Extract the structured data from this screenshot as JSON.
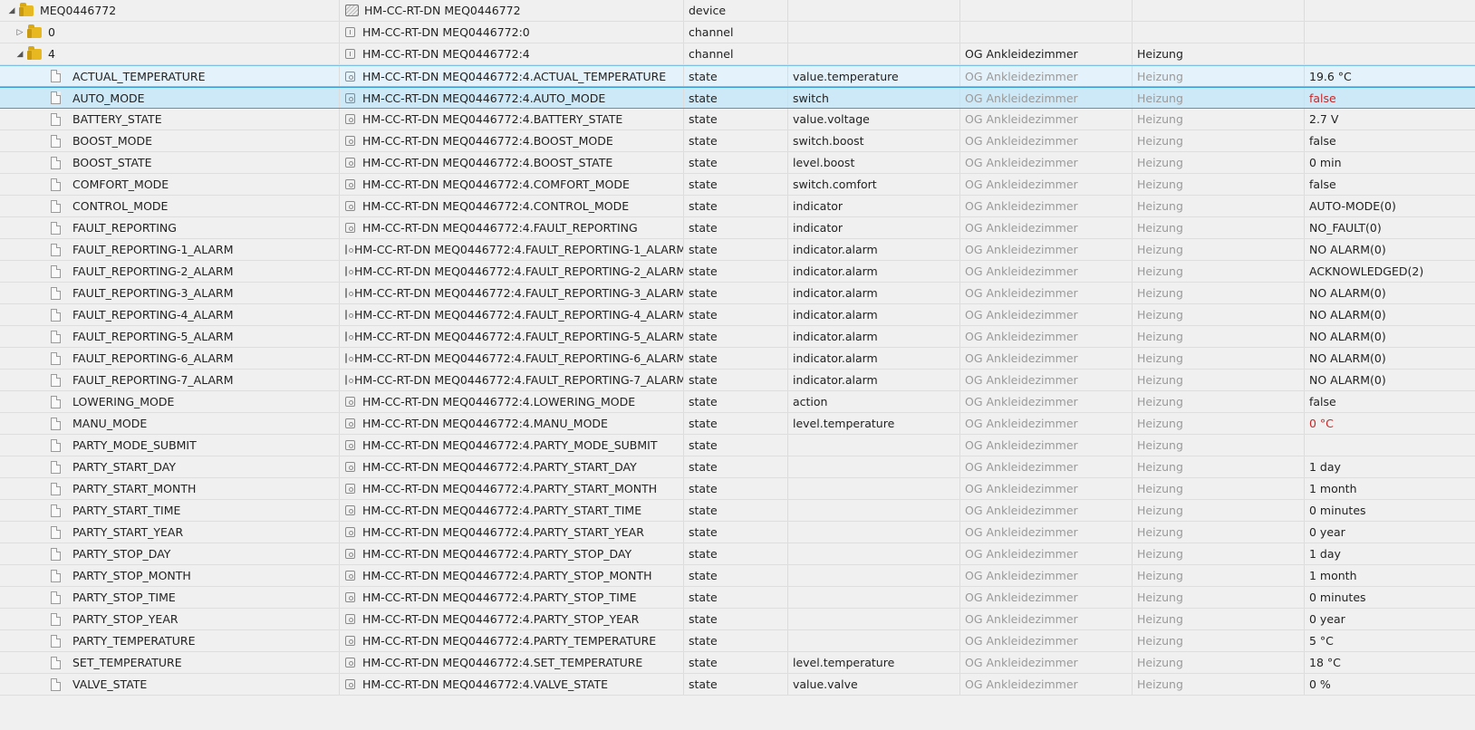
{
  "rows": [
    {
      "level": 0,
      "kind": "device",
      "toggle": "◢",
      "name": "MEQ0446772",
      "label": "HM-CC-RT-DN MEQ0446772",
      "type": "device",
      "role": "",
      "room": "",
      "function": "",
      "value": "",
      "icon": "folder-icon",
      "label_icon": "device-icon"
    },
    {
      "level": 1,
      "kind": "channel",
      "toggle": "▷",
      "name": "0",
      "label": "HM-CC-RT-DN MEQ0446772:0",
      "type": "channel",
      "role": "",
      "room": "",
      "function": "",
      "value": "",
      "icon": "folder-icon",
      "label_icon": "channel-icon"
    },
    {
      "level": 1,
      "kind": "channel",
      "toggle": "◢",
      "name": "4",
      "label": "HM-CC-RT-DN MEQ0446772:4",
      "type": "channel",
      "role": "",
      "room": "OG Ankleidezimmer",
      "function": "Heizung",
      "value": "",
      "icon": "folder-icon",
      "label_icon": "channel-icon"
    },
    {
      "level": 2,
      "kind": "state",
      "state": "hover",
      "name": "ACTUAL_TEMPERATURE",
      "label": "HM-CC-RT-DN MEQ0446772:4.ACTUAL_TEMPERATURE",
      "type": "state",
      "role": "value.temperature",
      "room": "OG Ankleidezimmer",
      "function": "Heizung",
      "value": "19.6 °C",
      "icon": "file-icon",
      "label_icon": "state-icon"
    },
    {
      "level": 2,
      "kind": "state",
      "state": "selected",
      "name": "AUTO_MODE",
      "label": "HM-CC-RT-DN MEQ0446772:4.AUTO_MODE",
      "type": "state",
      "role": "switch",
      "room": "OG Ankleidezimmer",
      "function": "Heizung",
      "value": "false",
      "value_color": "red",
      "icon": "file-icon",
      "label_icon": "state-icon"
    },
    {
      "level": 2,
      "kind": "state",
      "name": "BATTERY_STATE",
      "label": "HM-CC-RT-DN MEQ0446772:4.BATTERY_STATE",
      "type": "state",
      "role": "value.voltage",
      "room": "OG Ankleidezimmer",
      "function": "Heizung",
      "value": "2.7 V",
      "icon": "file-icon",
      "label_icon": "state-icon"
    },
    {
      "level": 2,
      "kind": "state",
      "name": "BOOST_MODE",
      "label": "HM-CC-RT-DN MEQ0446772:4.BOOST_MODE",
      "type": "state",
      "role": "switch.boost",
      "room": "OG Ankleidezimmer",
      "function": "Heizung",
      "value": "false",
      "icon": "file-icon",
      "label_icon": "state-icon"
    },
    {
      "level": 2,
      "kind": "state",
      "name": "BOOST_STATE",
      "label": "HM-CC-RT-DN MEQ0446772:4.BOOST_STATE",
      "type": "state",
      "role": "level.boost",
      "room": "OG Ankleidezimmer",
      "function": "Heizung",
      "value": "0 min",
      "icon": "file-icon",
      "label_icon": "state-icon"
    },
    {
      "level": 2,
      "kind": "state",
      "name": "COMFORT_MODE",
      "label": "HM-CC-RT-DN MEQ0446772:4.COMFORT_MODE",
      "type": "state",
      "role": "switch.comfort",
      "room": "OG Ankleidezimmer",
      "function": "Heizung",
      "value": "false",
      "icon": "file-icon",
      "label_icon": "state-icon"
    },
    {
      "level": 2,
      "kind": "state",
      "name": "CONTROL_MODE",
      "label": "HM-CC-RT-DN MEQ0446772:4.CONTROL_MODE",
      "type": "state",
      "role": "indicator",
      "room": "OG Ankleidezimmer",
      "function": "Heizung",
      "value": "AUTO-MODE(0)",
      "icon": "file-icon",
      "label_icon": "state-icon"
    },
    {
      "level": 2,
      "kind": "state",
      "name": "FAULT_REPORTING",
      "label": "HM-CC-RT-DN MEQ0446772:4.FAULT_REPORTING",
      "type": "state",
      "role": "indicator",
      "room": "OG Ankleidezimmer",
      "function": "Heizung",
      "value": "NO_FAULT(0)",
      "icon": "file-icon",
      "label_icon": "state-icon"
    },
    {
      "level": 2,
      "kind": "state",
      "name": "FAULT_REPORTING-1_ALARM",
      "label": "HM-CC-RT-DN MEQ0446772:4.FAULT_REPORTING-1_ALARM",
      "type": "state",
      "role": "indicator.alarm",
      "room": "OG Ankleidezimmer",
      "function": "Heizung",
      "value": "NO ALARM(0)",
      "icon": "file-icon",
      "label_icon": "state-icon"
    },
    {
      "level": 2,
      "kind": "state",
      "name": "FAULT_REPORTING-2_ALARM",
      "label": "HM-CC-RT-DN MEQ0446772:4.FAULT_REPORTING-2_ALARM",
      "type": "state",
      "role": "indicator.alarm",
      "room": "OG Ankleidezimmer",
      "function": "Heizung",
      "value": "ACKNOWLEDGED(2)",
      "icon": "file-icon",
      "label_icon": "state-icon"
    },
    {
      "level": 2,
      "kind": "state",
      "name": "FAULT_REPORTING-3_ALARM",
      "label": "HM-CC-RT-DN MEQ0446772:4.FAULT_REPORTING-3_ALARM",
      "type": "state",
      "role": "indicator.alarm",
      "room": "OG Ankleidezimmer",
      "function": "Heizung",
      "value": "NO ALARM(0)",
      "icon": "file-icon",
      "label_icon": "state-icon"
    },
    {
      "level": 2,
      "kind": "state",
      "name": "FAULT_REPORTING-4_ALARM",
      "label": "HM-CC-RT-DN MEQ0446772:4.FAULT_REPORTING-4_ALARM",
      "type": "state",
      "role": "indicator.alarm",
      "room": "OG Ankleidezimmer",
      "function": "Heizung",
      "value": "NO ALARM(0)",
      "icon": "file-icon",
      "label_icon": "state-icon"
    },
    {
      "level": 2,
      "kind": "state",
      "name": "FAULT_REPORTING-5_ALARM",
      "label": "HM-CC-RT-DN MEQ0446772:4.FAULT_REPORTING-5_ALARM",
      "type": "state",
      "role": "indicator.alarm",
      "room": "OG Ankleidezimmer",
      "function": "Heizung",
      "value": "NO ALARM(0)",
      "icon": "file-icon",
      "label_icon": "state-icon"
    },
    {
      "level": 2,
      "kind": "state",
      "name": "FAULT_REPORTING-6_ALARM",
      "label": "HM-CC-RT-DN MEQ0446772:4.FAULT_REPORTING-6_ALARM",
      "type": "state",
      "role": "indicator.alarm",
      "room": "OG Ankleidezimmer",
      "function": "Heizung",
      "value": "NO ALARM(0)",
      "icon": "file-icon",
      "label_icon": "state-icon"
    },
    {
      "level": 2,
      "kind": "state",
      "name": "FAULT_REPORTING-7_ALARM",
      "label": "HM-CC-RT-DN MEQ0446772:4.FAULT_REPORTING-7_ALARM",
      "type": "state",
      "role": "indicator.alarm",
      "room": "OG Ankleidezimmer",
      "function": "Heizung",
      "value": "NO ALARM(0)",
      "icon": "file-icon",
      "label_icon": "state-icon"
    },
    {
      "level": 2,
      "kind": "state",
      "name": "LOWERING_MODE",
      "label": "HM-CC-RT-DN MEQ0446772:4.LOWERING_MODE",
      "type": "state",
      "role": "action",
      "room": "OG Ankleidezimmer",
      "function": "Heizung",
      "value": "false",
      "icon": "file-icon",
      "label_icon": "state-icon"
    },
    {
      "level": 2,
      "kind": "state",
      "name": "MANU_MODE",
      "label": "HM-CC-RT-DN MEQ0446772:4.MANU_MODE",
      "type": "state",
      "role": "level.temperature",
      "room": "OG Ankleidezimmer",
      "function": "Heizung",
      "value": "0 °C",
      "value_color": "red",
      "icon": "file-icon",
      "label_icon": "state-icon"
    },
    {
      "level": 2,
      "kind": "state",
      "name": "PARTY_MODE_SUBMIT",
      "label": "HM-CC-RT-DN MEQ0446772:4.PARTY_MODE_SUBMIT",
      "type": "state",
      "role": "",
      "room": "OG Ankleidezimmer",
      "function": "Heizung",
      "value": "",
      "icon": "file-icon",
      "label_icon": "state-icon"
    },
    {
      "level": 2,
      "kind": "state",
      "name": "PARTY_START_DAY",
      "label": "HM-CC-RT-DN MEQ0446772:4.PARTY_START_DAY",
      "type": "state",
      "role": "",
      "room": "OG Ankleidezimmer",
      "function": "Heizung",
      "value": "1 day",
      "icon": "file-icon",
      "label_icon": "state-icon"
    },
    {
      "level": 2,
      "kind": "state",
      "name": "PARTY_START_MONTH",
      "label": "HM-CC-RT-DN MEQ0446772:4.PARTY_START_MONTH",
      "type": "state",
      "role": "",
      "room": "OG Ankleidezimmer",
      "function": "Heizung",
      "value": "1 month",
      "icon": "file-icon",
      "label_icon": "state-icon"
    },
    {
      "level": 2,
      "kind": "state",
      "name": "PARTY_START_TIME",
      "label": "HM-CC-RT-DN MEQ0446772:4.PARTY_START_TIME",
      "type": "state",
      "role": "",
      "room": "OG Ankleidezimmer",
      "function": "Heizung",
      "value": "0 minutes",
      "icon": "file-icon",
      "label_icon": "state-icon"
    },
    {
      "level": 2,
      "kind": "state",
      "name": "PARTY_START_YEAR",
      "label": "HM-CC-RT-DN MEQ0446772:4.PARTY_START_YEAR",
      "type": "state",
      "role": "",
      "room": "OG Ankleidezimmer",
      "function": "Heizung",
      "value": "0 year",
      "icon": "file-icon",
      "label_icon": "state-icon"
    },
    {
      "level": 2,
      "kind": "state",
      "name": "PARTY_STOP_DAY",
      "label": "HM-CC-RT-DN MEQ0446772:4.PARTY_STOP_DAY",
      "type": "state",
      "role": "",
      "room": "OG Ankleidezimmer",
      "function": "Heizung",
      "value": "1 day",
      "icon": "file-icon",
      "label_icon": "state-icon"
    },
    {
      "level": 2,
      "kind": "state",
      "name": "PARTY_STOP_MONTH",
      "label": "HM-CC-RT-DN MEQ0446772:4.PARTY_STOP_MONTH",
      "type": "state",
      "role": "",
      "room": "OG Ankleidezimmer",
      "function": "Heizung",
      "value": "1 month",
      "icon": "file-icon",
      "label_icon": "state-icon"
    },
    {
      "level": 2,
      "kind": "state",
      "name": "PARTY_STOP_TIME",
      "label": "HM-CC-RT-DN MEQ0446772:4.PARTY_STOP_TIME",
      "type": "state",
      "role": "",
      "room": "OG Ankleidezimmer",
      "function": "Heizung",
      "value": "0 minutes",
      "icon": "file-icon",
      "label_icon": "state-icon"
    },
    {
      "level": 2,
      "kind": "state",
      "name": "PARTY_STOP_YEAR",
      "label": "HM-CC-RT-DN MEQ0446772:4.PARTY_STOP_YEAR",
      "type": "state",
      "role": "",
      "room": "OG Ankleidezimmer",
      "function": "Heizung",
      "value": "0 year",
      "icon": "file-icon",
      "label_icon": "state-icon"
    },
    {
      "level": 2,
      "kind": "state",
      "name": "PARTY_TEMPERATURE",
      "label": "HM-CC-RT-DN MEQ0446772:4.PARTY_TEMPERATURE",
      "type": "state",
      "role": "",
      "room": "OG Ankleidezimmer",
      "function": "Heizung",
      "value": "5 °C",
      "icon": "file-icon",
      "label_icon": "state-icon"
    },
    {
      "level": 2,
      "kind": "state",
      "name": "SET_TEMPERATURE",
      "label": "HM-CC-RT-DN MEQ0446772:4.SET_TEMPERATURE",
      "type": "state",
      "role": "level.temperature",
      "room": "OG Ankleidezimmer",
      "function": "Heizung",
      "value": "18 °C",
      "icon": "file-icon",
      "label_icon": "state-icon"
    },
    {
      "level": 2,
      "kind": "state",
      "name": "VALVE_STATE",
      "label": "HM-CC-RT-DN MEQ0446772:4.VALVE_STATE",
      "type": "state",
      "role": "value.valve",
      "room": "OG Ankleidezimmer",
      "function": "Heizung",
      "value": "0 %",
      "icon": "file-icon",
      "label_icon": "state-icon"
    }
  ],
  "colors": {
    "selected_bg": "#cde8f7",
    "selected_border": "#3b9fd6",
    "red_value": "#c62828",
    "folder": "#e8b820",
    "dim_text": "#9a9a9a"
  }
}
